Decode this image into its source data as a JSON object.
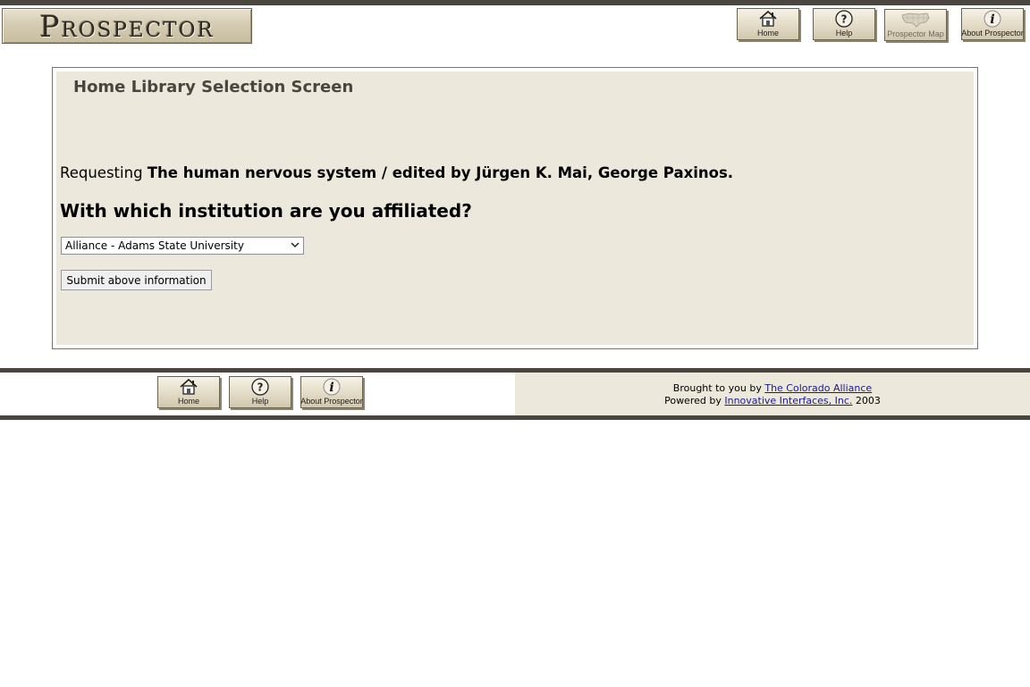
{
  "header": {
    "logo_text": "Prospector",
    "nav": [
      {
        "label": "Home",
        "icon": "home-icon"
      },
      {
        "label": "Help",
        "icon": "help-icon"
      },
      {
        "label": "Prospector Map",
        "icon": "map-icon"
      },
      {
        "label": "About Prospector",
        "icon": "info-icon"
      }
    ]
  },
  "main": {
    "title": "Home Library Selection Screen",
    "requesting_prefix": "Requesting",
    "requesting_title": "The human nervous system / edited by Jürgen K. Mai, George Paxinos.",
    "question": "With which institution are you affiliated?",
    "institution_selected": "Alliance - Adams State University",
    "submit_label": "Submit above information"
  },
  "footer": {
    "nav": [
      {
        "label": "Home",
        "icon": "home-icon"
      },
      {
        "label": "Help",
        "icon": "help-icon"
      },
      {
        "label": "About Prospector",
        "icon": "info-icon"
      }
    ],
    "brought_prefix": "Brought to you by",
    "brought_link": "The Colorado Alliance",
    "powered_prefix": "Powered by",
    "powered_link": "Innovative Interfaces, Inc.",
    "powered_year": "2003"
  },
  "colors": {
    "rule": "#4a463f",
    "panel_bg": "#ede8dc",
    "link": "#1a1a8c"
  }
}
